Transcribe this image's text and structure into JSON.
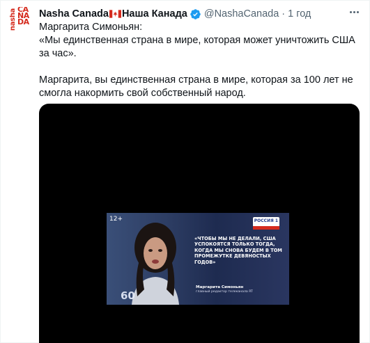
{
  "account": {
    "display_name": "Nasha Canada",
    "display_name_ru": "Наша Канада",
    "handle": "@NashaCanada",
    "separator": "·",
    "time": "1 год",
    "avatar_small": "nasha",
    "avatar_big": [
      "CA",
      "NA",
      "DA"
    ]
  },
  "tweet": {
    "line1": "Маргарита Симоньян:",
    "line2": "«Мы единственная страна в мире, которая может уничтожить США за час».",
    "line3": "Маргарита, вы единственная страна в мире, которая за 100 лет не смогла накормить свой собственный народ."
  },
  "media": {
    "rating": "12+",
    "channel": "РОССИЯ 1",
    "quote": "«Чтобы мы не делали, США успокоятся только тогда, когда мы снова будем в том промежутке девяностых годов»",
    "speaker_name": "Маргарита Симоньян",
    "speaker_role": "главный редактор телеканала RT",
    "show_logo": "60"
  },
  "icons": {
    "flag": "canada-flag-icon",
    "verified": "verified-badge-icon",
    "more": "more-options-icon"
  },
  "colors": {
    "brand_red": "#d52b1e",
    "verified_blue": "#1d9bf0",
    "muted": "#536471"
  }
}
